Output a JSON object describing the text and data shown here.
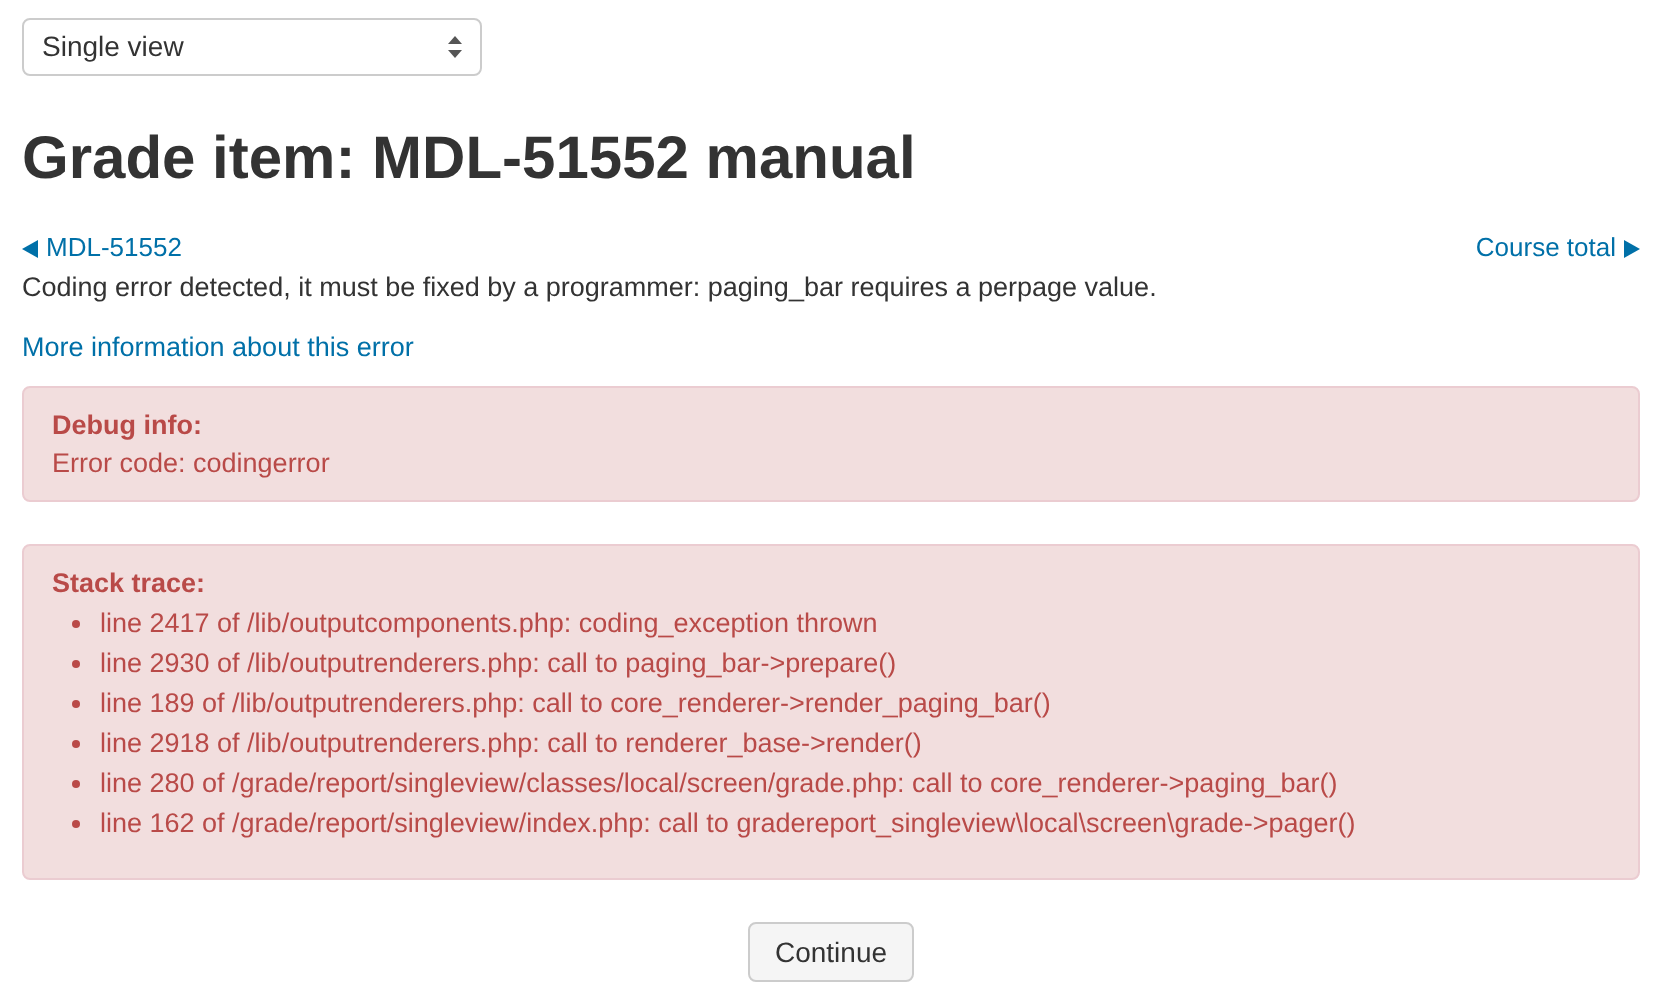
{
  "view_select": {
    "value": "Single view"
  },
  "heading": "Grade item: MDL-51552 manual",
  "nav": {
    "previous": "MDL-51552",
    "next": "Course total"
  },
  "error_message": "Coding error detected, it must be fixed by a programmer: paging_bar requires a perpage value.",
  "more_info_link": "More information about this error",
  "debug_info": {
    "title": "Debug info:",
    "text": "Error code: codingerror"
  },
  "stack_trace": {
    "title": "Stack trace:",
    "lines": [
      "line 2417 of /lib/outputcomponents.php: coding_exception thrown",
      "line 2930 of /lib/outputrenderers.php: call to paging_bar->prepare()",
      "line 189 of /lib/outputrenderers.php: call to core_renderer->render_paging_bar()",
      "line 2918 of /lib/outputrenderers.php: call to renderer_base->render()",
      "line 280 of /grade/report/singleview/classes/local/screen/grade.php: call to core_renderer->paging_bar()",
      "line 162 of /grade/report/singleview/index.php: call to gradereport_singleview\\local\\screen\\grade->pager()"
    ]
  },
  "continue_button": "Continue"
}
